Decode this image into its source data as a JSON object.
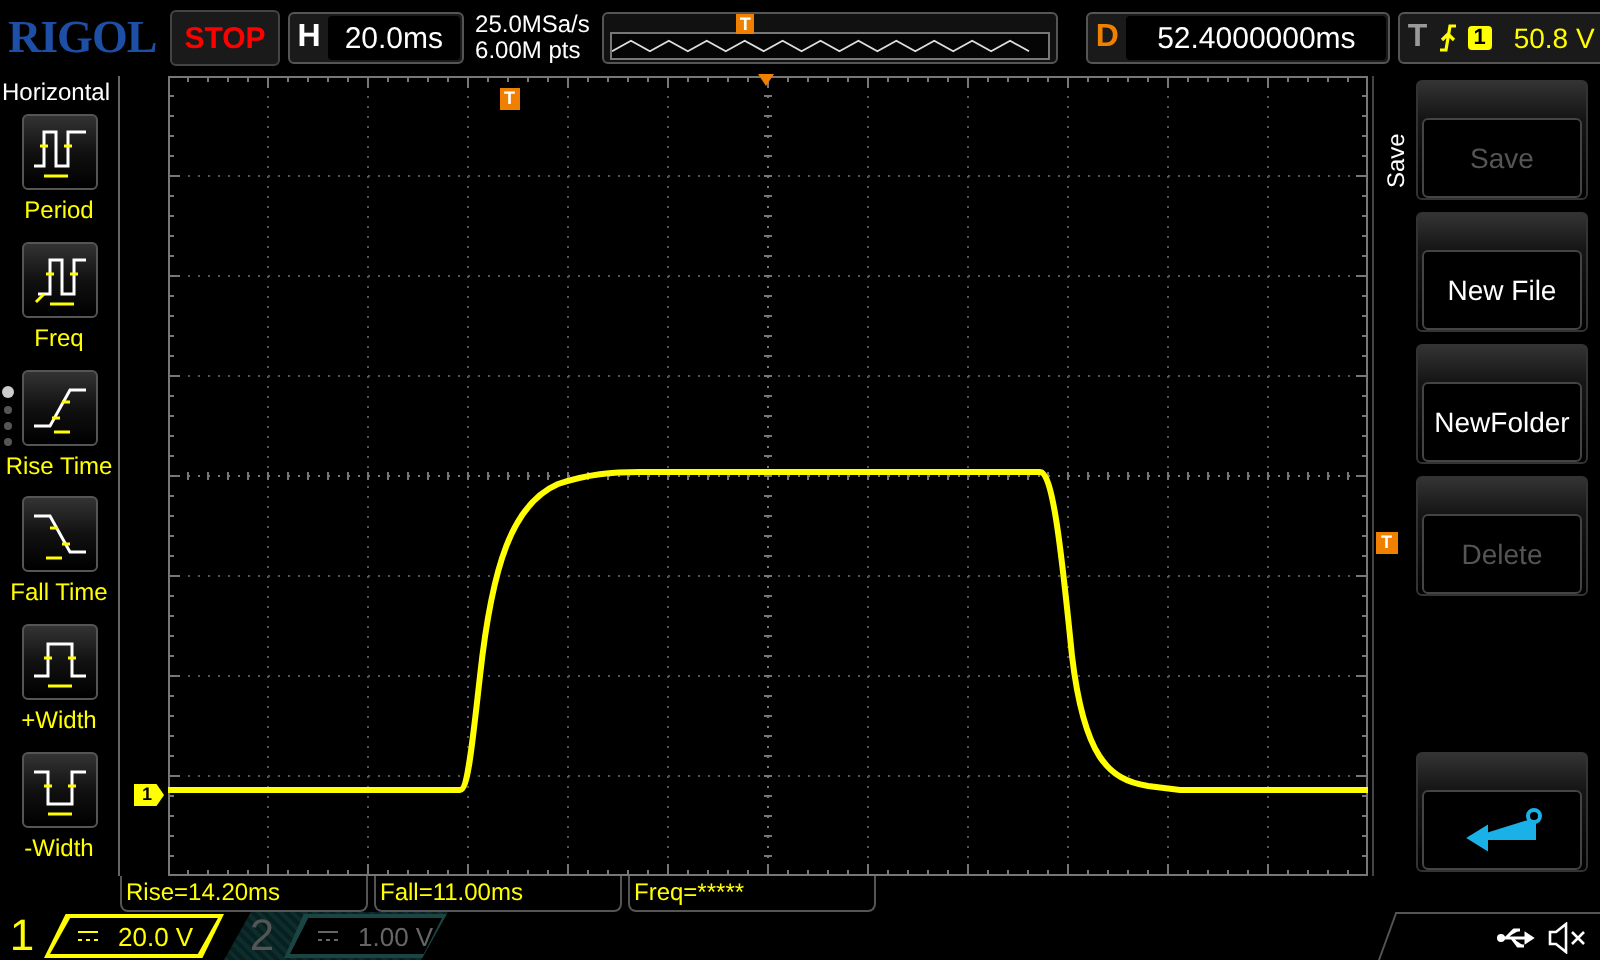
{
  "header": {
    "logo": "RIGOL",
    "run_state": "STOP",
    "timebase": {
      "label": "H",
      "value": "20.0ms"
    },
    "sample_rate": "25.0MSa/s",
    "memory_depth": "6.00M pts",
    "overview": {
      "marker": "T"
    },
    "delay": {
      "label": "D",
      "value": "52.4000000ms"
    },
    "trigger": {
      "label": "T",
      "source": "1",
      "level": "50.8 V"
    }
  },
  "menu": {
    "title": "Horizontal",
    "pages": [
      {
        "selected": true
      },
      {
        "selected": false
      },
      {
        "selected": false
      },
      {
        "selected": false
      }
    ],
    "items": [
      {
        "kind": "period",
        "label": "Period"
      },
      {
        "kind": "freq",
        "label": "Freq"
      },
      {
        "kind": "rise",
        "label": "Rise Time"
      },
      {
        "kind": "fall",
        "label": "Fall Time"
      },
      {
        "kind": "pos_width",
        "label": "+Width"
      },
      {
        "kind": "neg_width",
        "label": "-Width"
      }
    ]
  },
  "display": {
    "trigger_position_marker": "T",
    "channel_marker": "1",
    "trigger_level_marker": "T"
  },
  "measurements": [
    "Rise=14.20ms",
    "Fall=11.00ms",
    "Freq=*****"
  ],
  "softkeys": {
    "title": "Save",
    "keys": [
      {
        "kind": "text",
        "label": "Save",
        "disabled": true
      },
      {
        "kind": "text",
        "label": "New File",
        "disabled": false
      },
      {
        "kind": "text",
        "label": "NewFolder",
        "disabled": false
      },
      {
        "kind": "text",
        "label": "Delete",
        "disabled": true
      },
      {
        "kind": "back",
        "disabled": false
      }
    ]
  },
  "channels": [
    {
      "number": "1",
      "scale": "20.0 V",
      "selected": true
    },
    {
      "number": "2",
      "scale": "1.00 V",
      "selected": false
    }
  ]
}
